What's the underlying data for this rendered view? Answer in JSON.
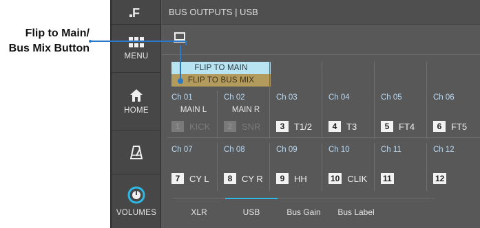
{
  "callout": {
    "line1": "Flip to Main/",
    "line2": "Bus Mix Button"
  },
  "sidebar": {
    "logo": "F",
    "items": [
      {
        "label": "MENU",
        "icon": "grid-icon"
      },
      {
        "label": "HOME",
        "icon": "home-icon"
      },
      {
        "label": "",
        "icon": "metronome-icon"
      },
      {
        "label": "VOLUMES",
        "icon": "volume-knob-icon"
      }
    ]
  },
  "header": {
    "title": "BUS OUTPUTS | USB"
  },
  "flip": {
    "main_label": "FLIP TO MAIN",
    "bus_label": "FLIP TO BUS MIX"
  },
  "channels": [
    {
      "ch": "Ch 01",
      "bus": "MAIN L",
      "num": "1",
      "src": "KICK",
      "dim": true
    },
    {
      "ch": "Ch 02",
      "bus": "MAIN R",
      "num": "2",
      "src": "SNR",
      "dim": true
    },
    {
      "ch": "Ch 03",
      "bus": "",
      "num": "3",
      "src": "T1/2",
      "dim": false
    },
    {
      "ch": "Ch 04",
      "bus": "",
      "num": "4",
      "src": "T3",
      "dim": false
    },
    {
      "ch": "Ch 05",
      "bus": "",
      "num": "5",
      "src": "FT4",
      "dim": false
    },
    {
      "ch": "Ch 06",
      "bus": "",
      "num": "6",
      "src": "FT5",
      "dim": false
    },
    {
      "ch": "Ch 07",
      "bus": "",
      "num": "7",
      "src": "CY L",
      "dim": false
    },
    {
      "ch": "Ch 08",
      "bus": "",
      "num": "8",
      "src": "CY R",
      "dim": false
    },
    {
      "ch": "Ch 09",
      "bus": "",
      "num": "9",
      "src": "HH",
      "dim": false
    },
    {
      "ch": "Ch 10",
      "bus": "",
      "num": "10",
      "src": "CLIK",
      "dim": false
    },
    {
      "ch": "Ch 11",
      "bus": "",
      "num": "11",
      "src": "",
      "dim": false
    },
    {
      "ch": "Ch 12",
      "bus": "",
      "num": "12",
      "src": "",
      "dim": false
    }
  ],
  "tabs": [
    {
      "label": "XLR",
      "active": false
    },
    {
      "label": "USB",
      "active": true
    },
    {
      "label": "Bus Gain",
      "active": false
    },
    {
      "label": "Bus Label",
      "active": false
    }
  ],
  "colors": {
    "accent": "#2db8e6",
    "flip_main_bg": "#b8e4f2",
    "flip_bus_bg": "#b39b5e",
    "callout_line": "#2a78c8"
  }
}
